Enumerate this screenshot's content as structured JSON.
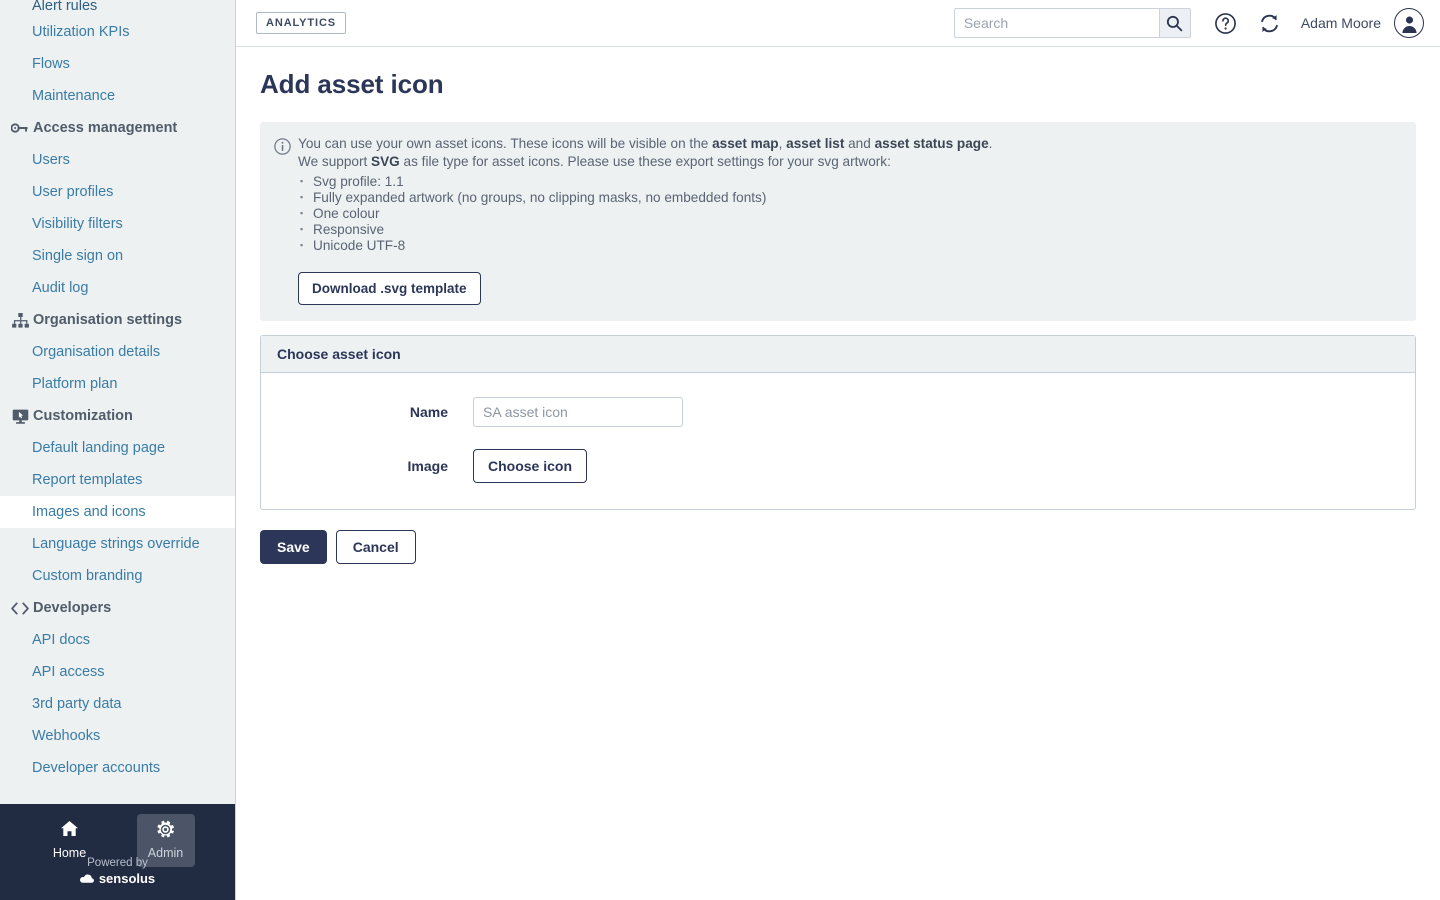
{
  "sidebar": {
    "items": [
      {
        "type": "link",
        "label": "Alert rules",
        "name": "alert-rules",
        "active": false,
        "clipped": true
      },
      {
        "type": "link",
        "label": "Utilization KPIs",
        "name": "utilization-kpis",
        "active": false
      },
      {
        "type": "link",
        "label": "Flows",
        "name": "flows",
        "active": false
      },
      {
        "type": "link",
        "label": "Maintenance",
        "name": "maintenance",
        "active": false
      },
      {
        "type": "group",
        "label": "Access management",
        "name": "access-management",
        "icon": "key-icon"
      },
      {
        "type": "link",
        "label": "Users",
        "name": "users",
        "active": false
      },
      {
        "type": "link",
        "label": "User profiles",
        "name": "user-profiles",
        "active": false
      },
      {
        "type": "link",
        "label": "Visibility filters",
        "name": "visibility-filters",
        "active": false
      },
      {
        "type": "link",
        "label": "Single sign on",
        "name": "single-sign-on",
        "active": false
      },
      {
        "type": "link",
        "label": "Audit log",
        "name": "audit-log",
        "active": false
      },
      {
        "type": "group",
        "label": "Organisation settings",
        "name": "organisation-settings",
        "icon": "org-chart-icon"
      },
      {
        "type": "link",
        "label": "Organisation details",
        "name": "organisation-details",
        "active": false
      },
      {
        "type": "link",
        "label": "Platform plan",
        "name": "platform-plan",
        "active": false
      },
      {
        "type": "group",
        "label": "Customization",
        "name": "customization",
        "icon": "display-cursor-icon"
      },
      {
        "type": "link",
        "label": "Default landing page",
        "name": "default-landing-page",
        "active": false
      },
      {
        "type": "link",
        "label": "Report templates",
        "name": "report-templates",
        "active": false
      },
      {
        "type": "link",
        "label": "Images and icons",
        "name": "images-and-icons",
        "active": true
      },
      {
        "type": "link",
        "label": "Language strings override",
        "name": "language-strings-override",
        "active": false
      },
      {
        "type": "link",
        "label": "Custom branding",
        "name": "custom-branding",
        "active": false
      },
      {
        "type": "group",
        "label": "Developers",
        "name": "developers",
        "icon": "code-brackets-icon"
      },
      {
        "type": "link",
        "label": "API docs",
        "name": "api-docs",
        "active": false
      },
      {
        "type": "link",
        "label": "API access",
        "name": "api-access",
        "active": false
      },
      {
        "type": "link",
        "label": "3rd party data",
        "name": "3rd-party-data",
        "active": false
      },
      {
        "type": "link",
        "label": "Webhooks",
        "name": "webhooks",
        "active": false
      },
      {
        "type": "link",
        "label": "Developer accounts",
        "name": "developer-accounts",
        "active": false
      }
    ],
    "footer": {
      "home_label": "Home",
      "admin_label": "Admin",
      "powered_by": "Powered by",
      "brand": "sensolus",
      "selected": "Admin"
    }
  },
  "header": {
    "badge": "ANALYTICS",
    "search_placeholder": "Search",
    "search_value": "",
    "help_icon": "question-circle-icon",
    "refresh_icon": "refresh-icon",
    "user_name": "Adam Moore",
    "avatar_icon": "user-avatar-icon"
  },
  "page": {
    "title": "Add asset icon",
    "notice": {
      "icon": "info-circle-icon",
      "line1_a": "You can use your own asset icons.  These icons will be visible on the ",
      "link1": "asset map",
      "line1_b": ", ",
      "link2": "asset list",
      "line1_c": " and ",
      "link3": "asset status page",
      "line1_d": ".",
      "line2_a": "We support ",
      "line2_b": "SVG",
      "line2_c": " as file type for asset icons. Please use these export settings for your svg artwork:",
      "bullets": [
        "Svg profile: 1.1",
        "Fully expanded artwork (no groups, no clipping masks, no embedded fonts)",
        "One colour",
        "Responsive",
        "Unicode UTF-8"
      ],
      "download_label": "Download .svg template"
    },
    "panel": {
      "heading": "Choose asset icon",
      "name_label": "Name",
      "name_placeholder": "SA asset icon",
      "name_value": "",
      "image_label": "Image",
      "choose_icon_label": "Choose icon"
    },
    "actions": {
      "save_label": "Save",
      "cancel_label": "Cancel"
    }
  },
  "colors": {
    "sidebar_bg": "#edf1f2",
    "sidebar_link": "#3a7ca5",
    "sidebar_group": "#515c6b",
    "footer_bg": "#212b42",
    "primary": "#2c3658",
    "notice_bg": "#edf1f2",
    "panel_border": "#c6cfd8"
  }
}
